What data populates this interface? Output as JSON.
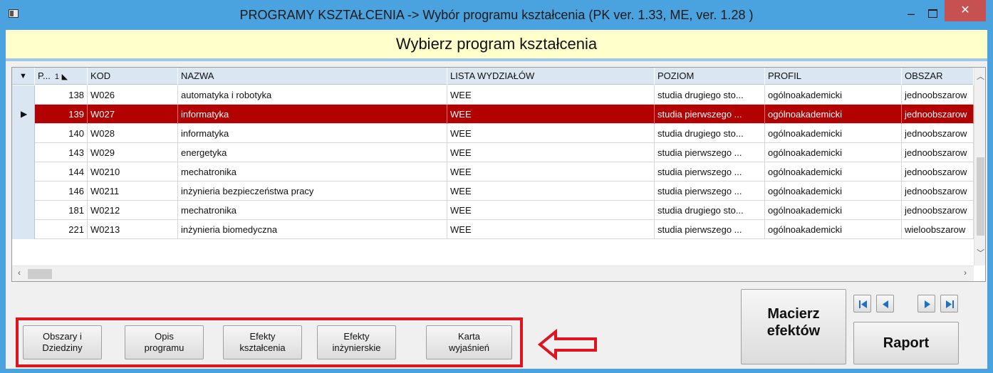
{
  "window": {
    "title": "PROGRAMY KSZTAŁCENIA -> Wybór programu kształcenia (PK ver. 1.33, ME, ver. 1.28 )",
    "minimize": "–",
    "close": "✕"
  },
  "header": {
    "title": "Wybierz program kształcenia"
  },
  "grid": {
    "columns": [
      {
        "label": "P...",
        "sort": "1"
      },
      {
        "label": "KOD"
      },
      {
        "label": "NAZWA"
      },
      {
        "label": "LISTA WYDZIAŁÓW"
      },
      {
        "label": "POZIOM"
      },
      {
        "label": "PROFIL"
      },
      {
        "label": "OBSZAR"
      }
    ],
    "rows": [
      {
        "id": "138",
        "kod": "W026",
        "nazwa": "automatyka i robotyka",
        "lista": "WEE",
        "poziom": "studia drugiego sto...",
        "profil": "ogólnoakademicki",
        "obszar": "jednoobszarow"
      },
      {
        "id": "139",
        "kod": "W027",
        "nazwa": "informatyka",
        "lista": "WEE",
        "poziom": "studia pierwszego ...",
        "profil": "ogólnoakademicki",
        "obszar": "jednoobszarow"
      },
      {
        "id": "140",
        "kod": "W028",
        "nazwa": "informatyka",
        "lista": "WEE",
        "poziom": "studia drugiego sto...",
        "profil": "ogólnoakademicki",
        "obszar": "jednoobszarow"
      },
      {
        "id": "143",
        "kod": "W029",
        "nazwa": "energetyka",
        "lista": "WEE",
        "poziom": "studia pierwszego ...",
        "profil": "ogólnoakademicki",
        "obszar": "jednoobszarow"
      },
      {
        "id": "144",
        "kod": "W0210",
        "nazwa": "mechatronika",
        "lista": "WEE",
        "poziom": "studia pierwszego ...",
        "profil": "ogólnoakademicki",
        "obszar": "jednoobszarow"
      },
      {
        "id": "146",
        "kod": "W0211",
        "nazwa": "inżynieria bezpieczeństwa pracy",
        "lista": "WEE",
        "poziom": "studia pierwszego ...",
        "profil": "ogólnoakademicki",
        "obszar": "jednoobszarow"
      },
      {
        "id": "181",
        "kod": "W0212",
        "nazwa": "mechatronika",
        "lista": "WEE",
        "poziom": "studia drugiego sto...",
        "profil": "ogólnoakademicki",
        "obszar": "jednoobszarow"
      },
      {
        "id": "221",
        "kod": "W0213",
        "nazwa": "inżynieria biomedyczna",
        "lista": "WEE",
        "poziom": "studia pierwszego ...",
        "profil": "ogólnoakademicki",
        "obszar": "wieloobszarow"
      }
    ],
    "selected_id": "139"
  },
  "buttons": {
    "obszary_line1": "Obszary i",
    "obszary_line2": "Dziedziny",
    "opis_line1": "Opis",
    "opis_line2": "programu",
    "efekty_k_line1": "Efekty",
    "efekty_k_line2": "kształcenia",
    "efekty_i_line1": "Efekty",
    "efekty_i_line2": "inżynierskie",
    "karta_line1": "Karta",
    "karta_line2": "wyjaśnień",
    "macierz_line1": "Macierz",
    "macierz_line2": "efektów",
    "raport": "Raport"
  },
  "colors": {
    "selected_row": "#b30000",
    "header_bg": "#ffffcc",
    "annotation": "#e0141e",
    "titlebar": "#4aa3df"
  }
}
